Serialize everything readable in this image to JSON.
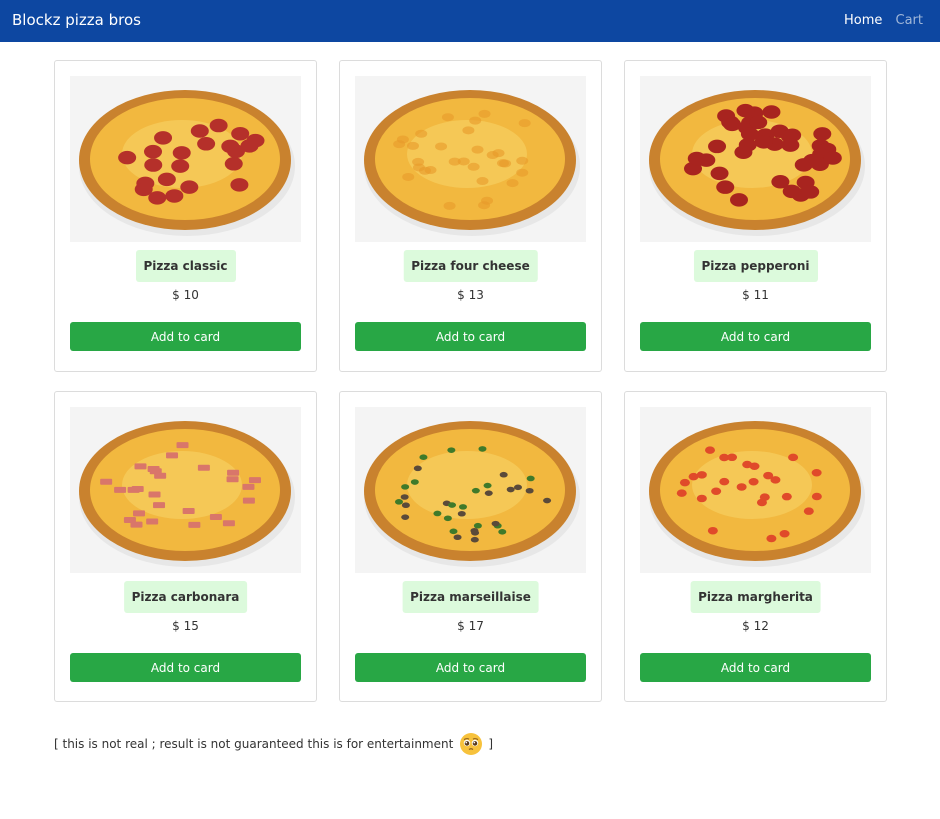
{
  "navbar": {
    "brand": "Blockz pizza bros",
    "links": {
      "home": "Home",
      "cart": "Cart"
    }
  },
  "products": [
    {
      "name": "Pizza classic",
      "price": "$ 10",
      "button": "Add to card",
      "topping": "pepperoni-mix"
    },
    {
      "name": "Pizza four cheese",
      "price": "$ 13",
      "button": "Add to card",
      "topping": "cheese"
    },
    {
      "name": "Pizza pepperoni",
      "price": "$ 11",
      "button": "Add to card",
      "topping": "pepperoni"
    },
    {
      "name": "Pizza carbonara",
      "price": "$ 15",
      "button": "Add to card",
      "topping": "bacon"
    },
    {
      "name": "Pizza marseillaise",
      "price": "$ 17",
      "button": "Add to card",
      "topping": "mushroom-herb"
    },
    {
      "name": "Pizza margherita",
      "price": "$ 12",
      "button": "Add to card",
      "topping": "tomato"
    }
  ],
  "footer": {
    "disclaimer_open": "[ this is not real ; result is not guaranteed this is for entertainment",
    "disclaimer_close": "]",
    "emoji": "pleading-face-icon"
  },
  "colors": {
    "navbar": "#0d47a1",
    "button": "#28a745",
    "name_badge": "#dcfadc"
  }
}
